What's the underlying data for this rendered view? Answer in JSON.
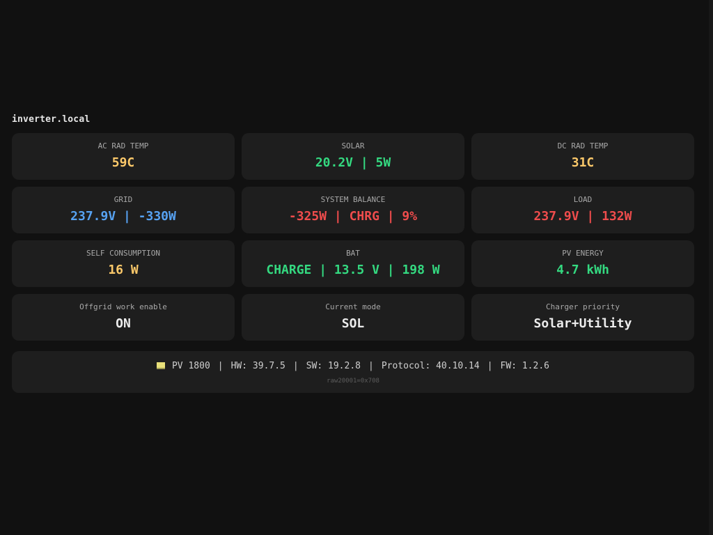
{
  "host": "inverter.local",
  "cards": [
    {
      "label": "AC RAD TEMP",
      "value": "59C",
      "color": "#fcc96a"
    },
    {
      "label": "SOLAR",
      "value": "20.2V | 5W",
      "color": "#34d980"
    },
    {
      "label": "DC RAD TEMP",
      "value": "31C",
      "color": "#fcc96a"
    },
    {
      "label": "GRID",
      "value": "237.9V | -330W",
      "color": "#57a2f2"
    },
    {
      "label": "SYSTEM BALANCE",
      "value": "-325W | CHRG | 9%",
      "color": "#ef4c4c"
    },
    {
      "label": "LOAD",
      "value": "237.9V | 132W",
      "color": "#ef4c4c"
    },
    {
      "label": "SELF CONSUMPTION",
      "value": "16 W",
      "color": "#fcc96a"
    },
    {
      "label": "BAT",
      "value": "CHARGE | 13.5 V | 198 W",
      "color": "#34d980"
    },
    {
      "label": "PV ENERGY",
      "value": "4.7 kWh",
      "color": "#34d980"
    },
    {
      "label": "Offgrid work enable",
      "value": "ON",
      "color": "#ececec"
    },
    {
      "label": "Current mode",
      "value": "SOL",
      "color": "#ececec"
    },
    {
      "label": "Charger priority",
      "value": "Solar+Utility",
      "color": "#ececec"
    }
  ],
  "footer": {
    "icon": "device-icon",
    "model": "PV 1800",
    "hw": "HW: 39.7.5",
    "sw": "SW: 19.2.8",
    "protocol": "Protocol: 40.10.14",
    "fw": "FW: 1.2.6",
    "separator": "|",
    "raw": "raw20001=0x708"
  }
}
